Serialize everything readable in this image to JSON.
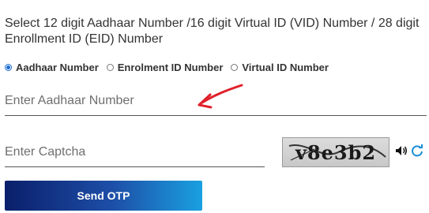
{
  "instruction": "Select 12 digit Aadhaar Number /16 digit Virtual ID (VID) Number / 28 digit Enrollment ID (EID) Number",
  "id_type": {
    "selected": "Aadhaar Number",
    "options": [
      {
        "label": "Aadhaar Number"
      },
      {
        "label": "Enrolment ID Number"
      },
      {
        "label": "Virtual ID Number"
      }
    ]
  },
  "aadhaar_field": {
    "placeholder": "Enter Aadhaar Number",
    "value": ""
  },
  "captcha_field": {
    "placeholder": "Enter Captcha",
    "value": ""
  },
  "captcha_image": {
    "text": "v8e3b2"
  },
  "icons": {
    "audio": "speaker-icon",
    "refresh": "refresh-icon",
    "arrow": "annotation-arrow"
  },
  "send_button": {
    "label": "Send OTP"
  },
  "colors": {
    "accent": "#1a6bd1",
    "button_start": "#0a1f6b",
    "button_end": "#1aa0e0",
    "arrow": "#e0202a"
  }
}
